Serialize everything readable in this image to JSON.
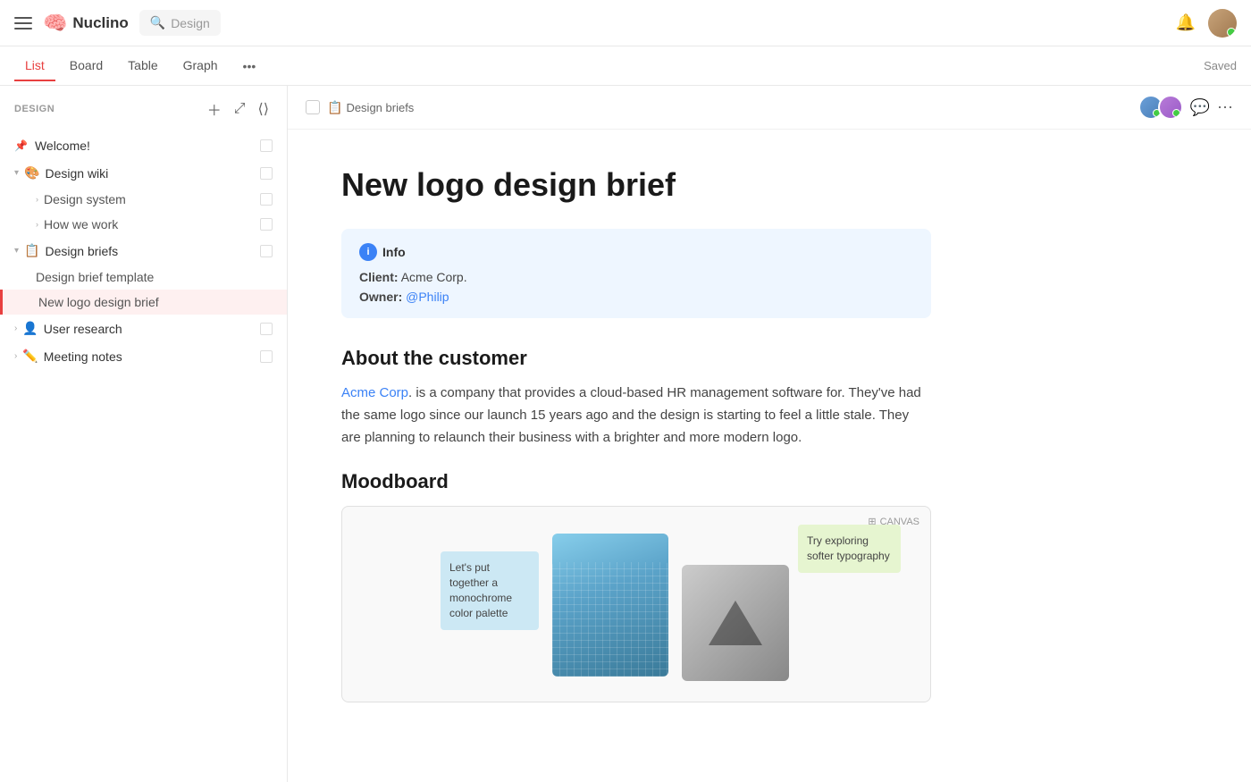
{
  "app": {
    "name": "Nuclino",
    "search_placeholder": "Design"
  },
  "navbar": {
    "saved_label": "Saved"
  },
  "tabs": [
    {
      "id": "list",
      "label": "List",
      "active": true
    },
    {
      "id": "board",
      "label": "Board",
      "active": false
    },
    {
      "id": "table",
      "label": "Table",
      "active": false
    },
    {
      "id": "graph",
      "label": "Graph",
      "active": false
    }
  ],
  "sidebar": {
    "section_title": "DESIGN",
    "items": [
      {
        "id": "welcome",
        "label": "Welcome!",
        "icon": "📌",
        "type": "pinned"
      },
      {
        "id": "design-wiki",
        "label": "Design wiki",
        "icon": "🎨",
        "type": "group",
        "expanded": true,
        "children": [
          {
            "id": "design-system",
            "label": "Design system"
          },
          {
            "id": "how-we-work",
            "label": "How we work"
          }
        ]
      },
      {
        "id": "design-briefs",
        "label": "Design briefs",
        "icon": "📋",
        "type": "group",
        "expanded": true,
        "children": [
          {
            "id": "design-brief-template",
            "label": "Design brief template"
          },
          {
            "id": "new-logo-design-brief",
            "label": "New logo design brief",
            "active": true
          }
        ]
      },
      {
        "id": "user-research",
        "label": "User research",
        "icon": "👤",
        "type": "group",
        "expanded": false
      },
      {
        "id": "meeting-notes",
        "label": "Meeting notes",
        "icon": "✏️",
        "type": "group",
        "expanded": false
      }
    ]
  },
  "document": {
    "breadcrumb_icon": "📋",
    "breadcrumb_label": "Design briefs",
    "title": "New logo design brief",
    "info_title": "Info",
    "info_client_label": "Client:",
    "info_client_value": "Acme Corp.",
    "info_owner_label": "Owner:",
    "info_owner_value": "@Philip",
    "about_title": "About the customer",
    "about_paragraph_link": "Acme Corp",
    "about_paragraph": ". is a company that provides a cloud-based HR management software for. They've had the same logo since our launch 15 years ago and the design is starting to feel a little stale. They are planning to relaunch their business with a brighter and more modern logo.",
    "moodboard_title": "Moodboard",
    "canvas_label": "CANVAS",
    "sticky_blue_text": "Let's put together a monochrome color palette",
    "sticky_green_text": "Try exploring softer typography"
  }
}
